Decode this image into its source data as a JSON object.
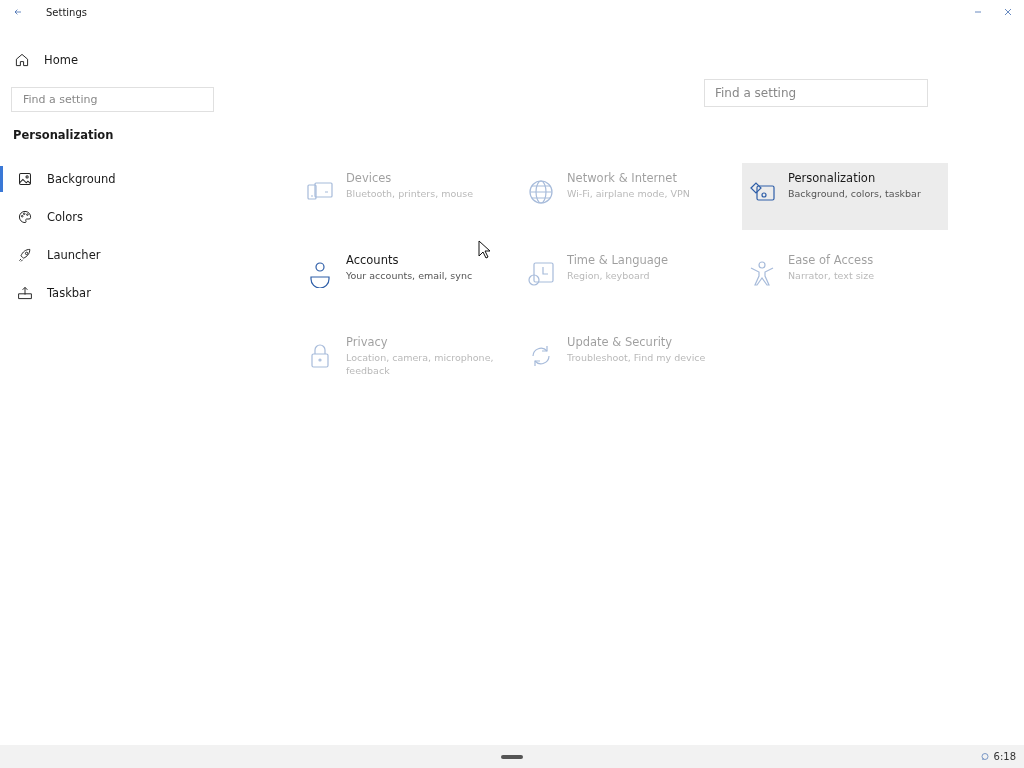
{
  "window": {
    "title": "Settings"
  },
  "sidebar": {
    "home": "Home",
    "search": {
      "placeholder": "Find a setting"
    },
    "section": "Personalization",
    "items": [
      {
        "label": "Background",
        "selected": true
      },
      {
        "label": "Colors",
        "selected": false
      },
      {
        "label": "Launcher",
        "selected": false
      },
      {
        "label": "Taskbar",
        "selected": false
      }
    ]
  },
  "main": {
    "search": {
      "placeholder": "Find a setting"
    },
    "tiles": [
      {
        "title": "Devices",
        "subtitle": "Bluetooth, printers, mouse",
        "faded": true,
        "selected": false
      },
      {
        "title": "Network & Internet",
        "subtitle": "Wi-Fi, airplane mode, VPN",
        "faded": true,
        "selected": false
      },
      {
        "title": "Personalization",
        "subtitle": "Background, colors, taskbar",
        "faded": false,
        "selected": true
      },
      {
        "title": "Accounts",
        "subtitle": "Your accounts, email, sync",
        "faded": false,
        "selected": false
      },
      {
        "title": "Time & Language",
        "subtitle": "Region, keyboard",
        "faded": true,
        "selected": false
      },
      {
        "title": "Ease of Access",
        "subtitle": "Narrator, text size",
        "faded": true,
        "selected": false
      },
      {
        "title": "Privacy",
        "subtitle": "Location, camera, microphone, feedback",
        "faded": true,
        "selected": false
      },
      {
        "title": "Update & Security",
        "subtitle": "Troubleshoot, Find my device",
        "faded": true,
        "selected": false
      }
    ]
  },
  "status_bar": {
    "time": "6:18"
  }
}
